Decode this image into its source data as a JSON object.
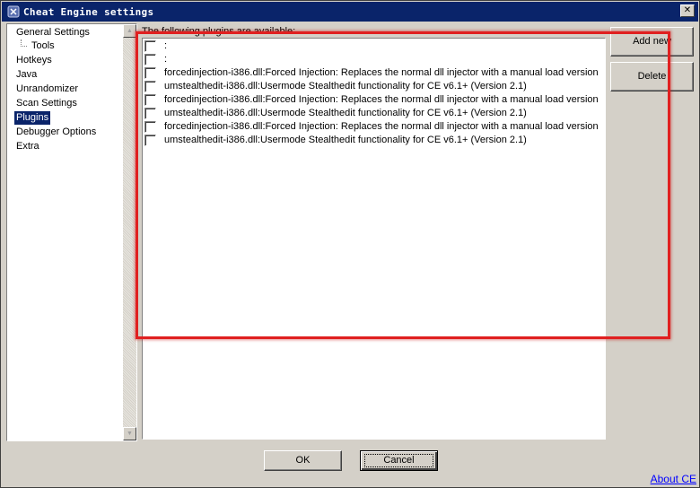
{
  "window": {
    "title": "Cheat Engine settings",
    "close_glyph": "✕"
  },
  "sidebar": {
    "items": [
      {
        "label": "General Settings"
      },
      {
        "label": "Tools"
      },
      {
        "label": "Hotkeys"
      },
      {
        "label": "Java"
      },
      {
        "label": "Unrandomizer"
      },
      {
        "label": "Scan Settings"
      },
      {
        "label": "Plugins",
        "selected": true
      },
      {
        "label": "Debugger Options"
      },
      {
        "label": "Extra"
      }
    ]
  },
  "plugins": {
    "label": "The following plugins are available:",
    "rows": [
      {
        "text": ":"
      },
      {
        "text": ":"
      },
      {
        "text": "forcedinjection-i386.dll:Forced Injection: Replaces the normal dll injector with a manual load version"
      },
      {
        "text": "umstealthedit-i386.dll:Usermode Stealthedit functionality for CE v6.1+ (Version 2.1)"
      },
      {
        "text": "forcedinjection-i386.dll:Forced Injection: Replaces the normal dll injector with a manual load version"
      },
      {
        "text": "umstealthedit-i386.dll:Usermode Stealthedit functionality for CE v6.1+ (Version 2.1)"
      },
      {
        "text": "forcedinjection-i386.dll:Forced Injection: Replaces the normal dll injector with a manual load version"
      },
      {
        "text": "umstealthedit-i386.dll:Usermode Stealthedit functionality for CE v6.1+ (Version 2.1)"
      }
    ]
  },
  "buttons": {
    "add_new": "Add new",
    "delete": "Delete",
    "ok": "OK",
    "cancel": "Cancel"
  },
  "about_link": "About CE",
  "colors": {
    "annotation": "#e02020",
    "selection": "#0a246a",
    "face": "#d4d0c8"
  }
}
